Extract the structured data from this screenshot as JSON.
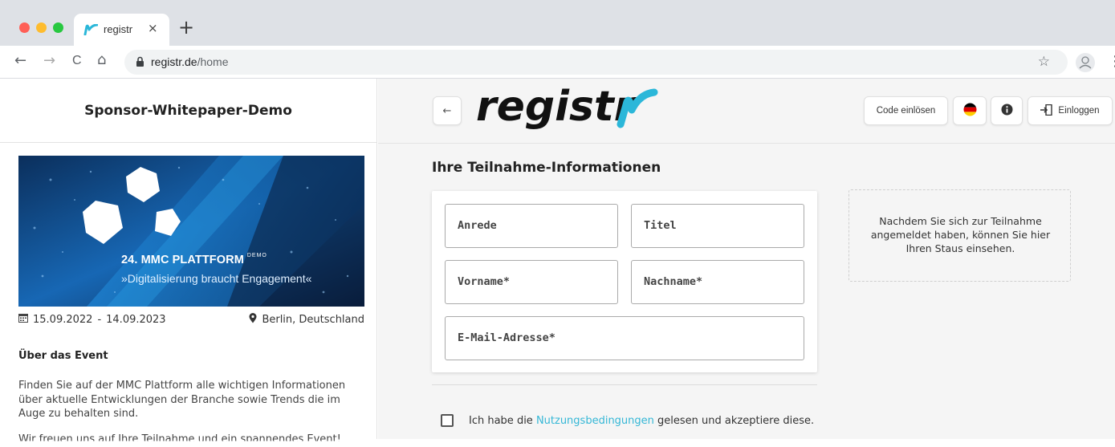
{
  "browser": {
    "tab_title": "registr",
    "tab_close": "×",
    "new_tab": "+",
    "url_host": "registr.de",
    "url_path": "/home",
    "nav": {
      "back": "←",
      "forward": "→",
      "reload": "C",
      "home": "⌂"
    },
    "star": "☆",
    "menu": "⋮"
  },
  "sidebar": {
    "title": "Sponsor-Whitepaper-Demo",
    "banner": {
      "title": "24. MMC PLATTFORM",
      "badge": "DEMO",
      "subtitle": "»Digitalisierung braucht Engagement«"
    },
    "date_start": "15.09.2022",
    "date_sep": "-",
    "date_end": "14.09.2023",
    "location": "Berlin, Deutschland",
    "about_title": "Über das Event",
    "about_text": "Finden Sie auf der MMC Plattform alle wichtigen Informationen über aktuelle Entwicklungen der Branche sowie Trends die im Auge zu behalten sind.",
    "about_text_cut": "Wir freuen uns auf Ihre Teilnahme und ein spannendes Event!"
  },
  "header": {
    "back": "←",
    "brand": "registr",
    "redeem_code": "Code einlösen",
    "login": "Einloggen"
  },
  "form": {
    "section_title": "Ihre Teilnahme-Informationen",
    "fields": {
      "salutation": "Anrede",
      "title": "Titel",
      "first_name": "Vorname*",
      "last_name": "Nachname*",
      "email": "E-Mail-Adresse*"
    },
    "status_text": "Nachdem Sie sich zur Teilnahme angemeldet haben, können Sie hier Ihren Staus einsehen.",
    "terms_prefix": "Ich habe die ",
    "terms_link": "Nutzungsbedingungen",
    "terms_suffix": " gelesen und akzeptiere diese."
  },
  "colors": {
    "brand_accent": "#2bb7d9",
    "link": "#34b7d6",
    "banner_blue": "#1e6fbf"
  },
  "icons": {
    "calendar": "calendar-icon",
    "location": "map-pin-icon",
    "language": "german-flag-icon",
    "info": "info-icon",
    "login": "login-door-icon",
    "lock": "lock-icon"
  }
}
